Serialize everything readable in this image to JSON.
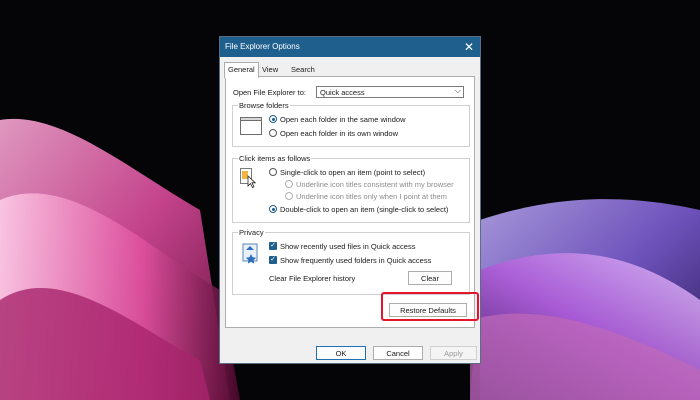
{
  "dialog": {
    "title": "File Explorer Options",
    "close_glyph": "✕"
  },
  "tabs": [
    "General",
    "View",
    "Search"
  ],
  "open_to": {
    "label": "Open File Explorer to:",
    "value": "Quick access",
    "chevron": "⌵"
  },
  "browse_folders": {
    "title": "Browse folders",
    "options": [
      {
        "label": "Open each folder in the same window",
        "selected": true
      },
      {
        "label": "Open each folder in its own window",
        "selected": false
      }
    ]
  },
  "click_items": {
    "title": "Click items as follows",
    "single_click": "Single-click to open an item (point to select)",
    "underline_browser": "Underline icon titles consistent with my browser",
    "underline_point": "Underline icon titles only when I point at them",
    "double_click": "Double-click to open an item (single-click to select)"
  },
  "privacy": {
    "title": "Privacy",
    "recent_files": "Show recently used files in Quick access",
    "frequent_folders": "Show frequently used folders in Quick access",
    "clear_label": "Clear File Explorer history",
    "clear_button": "Clear",
    "check_glyph": "✓"
  },
  "restore_defaults": "Restore Defaults",
  "footer": {
    "ok": "OK",
    "cancel": "Cancel",
    "apply": "Apply"
  },
  "colors": {
    "titlebar": "#1f5f8e",
    "highlight": "#e3152b",
    "accent": "#1f5f8e"
  }
}
